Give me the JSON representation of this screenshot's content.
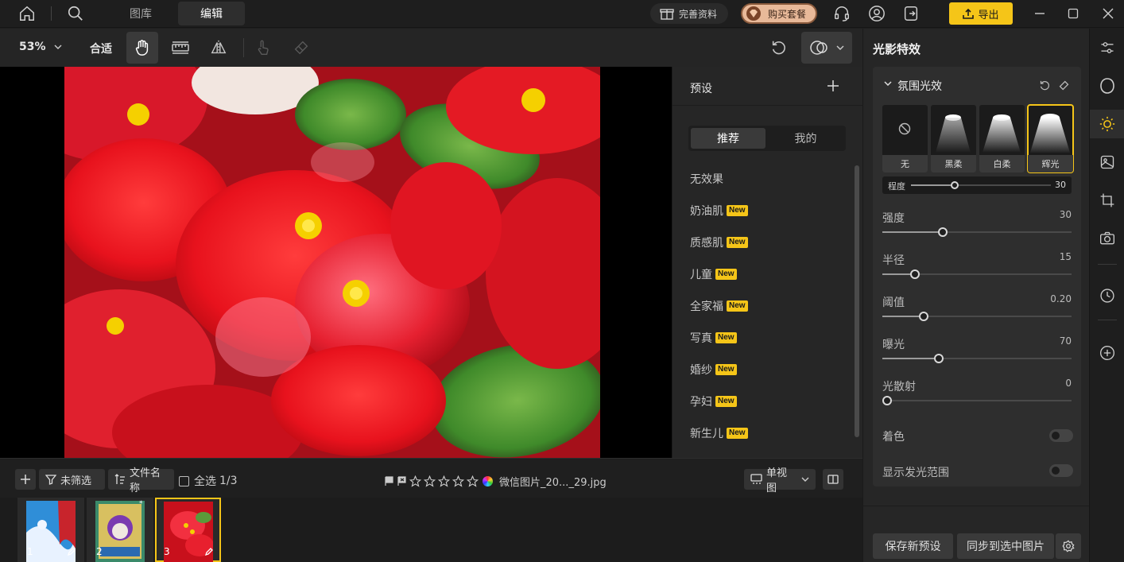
{
  "topbar": {
    "tabs": [
      {
        "label": "图库"
      },
      {
        "label": "编辑"
      }
    ],
    "complete_profile": "完善资料",
    "buy_plan": "购买套餐",
    "export": "导出"
  },
  "toolbar": {
    "zoom": "53%",
    "fit": "合适"
  },
  "presets": {
    "title": "预设",
    "tabs": [
      {
        "label": "推荐"
      },
      {
        "label": "我的"
      }
    ],
    "items": [
      {
        "label": "无效果",
        "badge": ""
      },
      {
        "label": "奶油肌",
        "badge": "New"
      },
      {
        "label": "质感肌",
        "badge": "New"
      },
      {
        "label": "儿童",
        "badge": "New"
      },
      {
        "label": "全家福",
        "badge": "New"
      },
      {
        "label": "写真",
        "badge": "New"
      },
      {
        "label": "婚纱",
        "badge": "New"
      },
      {
        "label": "孕妇",
        "badge": "New"
      },
      {
        "label": "新生儿",
        "badge": "New"
      }
    ]
  },
  "stripbar": {
    "filter": "未筛选",
    "filename_sort": "文件名称",
    "select_all": "全选",
    "count": "1/3",
    "file_name": "微信图片_20..._29.jpg",
    "view_mode": "单视图"
  },
  "thumbnails": [
    {
      "index": "1"
    },
    {
      "index": "2"
    },
    {
      "index": "3"
    }
  ],
  "right_panel": {
    "title": "光影特效",
    "section_title": "氛围光效",
    "effects": [
      {
        "label": "无"
      },
      {
        "label": "黑柔"
      },
      {
        "label": "白柔"
      },
      {
        "label": "辉光"
      }
    ],
    "degree": {
      "label": "程度",
      "value": "30",
      "level": 0.3
    },
    "sliders": [
      {
        "label": "强度",
        "value": "30",
        "level": 0.3
      },
      {
        "label": "半径",
        "value": "15",
        "level": 0.15
      },
      {
        "label": "阈值",
        "value": "0.20",
        "level": 0.2
      },
      {
        "label": "曝光",
        "value": "70",
        "level": 0.28
      },
      {
        "label": "光散射",
        "value": "0",
        "level": 0.0
      }
    ],
    "toggles": [
      {
        "label": "着色"
      },
      {
        "label": "显示发光范围"
      }
    ],
    "save_preset": "保存新预设",
    "sync": "同步到选中图片"
  },
  "colors": {
    "accent": "#f5c518",
    "bg": "#1e1e1e",
    "panel": "#262626"
  }
}
